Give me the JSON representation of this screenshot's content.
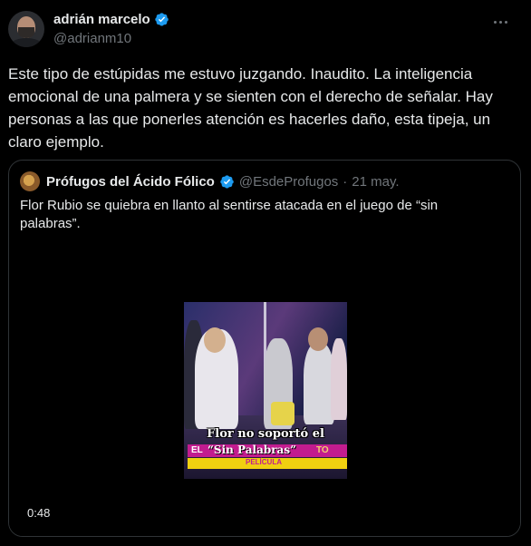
{
  "author": {
    "display_name": "adrián marcelo",
    "handle": "@adrianm10",
    "verified": true
  },
  "more_icon": "more-dots-icon",
  "tweet": {
    "text": "Este tipo de estúpidas me estuvo juzgando. Inaudito. La inteligencia emocional de una palmera y se sienten con el derecho de señalar. Hay personas a las que ponerles atención es hacerles daño, esta tipeja, un claro ejemplo."
  },
  "quoted": {
    "display_name": "Prófugos del Ácido Fólico",
    "handle": "@EsdeProfugos",
    "separator": "·",
    "date": "21 may.",
    "verified": true,
    "text": "Flor Rubio se quiebra en llanto al sentirse atacada en el juego de “sin palabras”.",
    "video": {
      "caption_line1": "Flor no soportó el",
      "banner_prefix": "EL",
      "banner_text": "“Sin Palabras”",
      "banner_suffix": "TO",
      "sub_banner": "PELÍCULA",
      "duration": "0:48"
    }
  },
  "colors": {
    "background": "#000000",
    "text_primary": "#e7e9ea",
    "text_secondary": "#71767b",
    "border": "#2f3336",
    "verified_blue": "#1d9bf0"
  }
}
